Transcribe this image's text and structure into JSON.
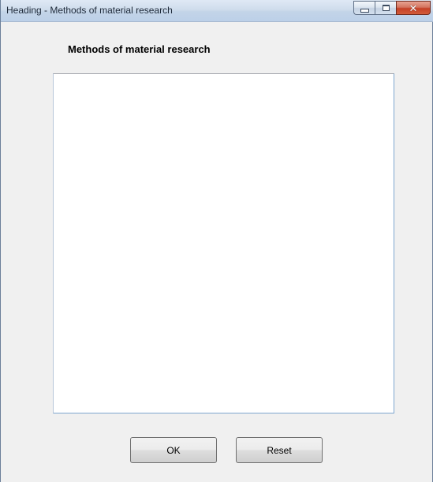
{
  "window": {
    "title": "Heading - Methods of material research",
    "controls": {
      "minimize": "minimize-icon",
      "maximize": "maximize-icon",
      "close": "close-icon"
    }
  },
  "form": {
    "heading": "Methods of material research",
    "text_value": "",
    "ok_label": "OK",
    "reset_label": "Reset"
  },
  "colors": {
    "window_background": "#f0f0f0",
    "close_button": "#c54127",
    "textarea_border": "#7ea6cf"
  }
}
